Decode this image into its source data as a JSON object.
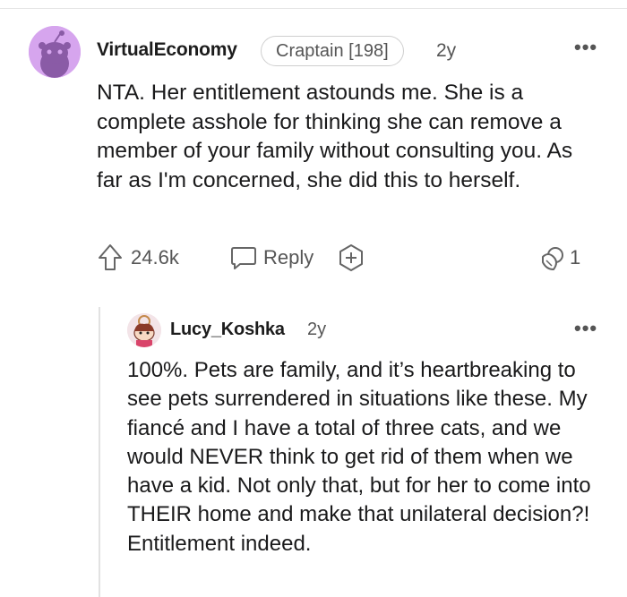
{
  "comment": {
    "username": "VirtualEconomy",
    "flair": "Craptain [198]",
    "age": "2y",
    "more_label": "•••",
    "text": "NTA. Her entitlement astounds me. She is a complete asshole for thinking she can remove a member of your family without consulting you. As far as I'm concerned, she did this to herself.",
    "upvotes": "24.6k",
    "reply_label": "Reply",
    "award_count": "1",
    "avatar_color": "#d6a5ee"
  },
  "reply": {
    "username": "Lucy_Koshka",
    "age": "2y",
    "more_label": "•••",
    "text": "100%. Pets are family, and it’s heartbreaking to see pets surrendered in situations like these. My fiancé and I have a total of three cats, and we would NEVER think to get rid of them when we have a kid. Not only that, but for her to come into THEIR home and make that unilateral decision?! Entitlement indeed."
  }
}
